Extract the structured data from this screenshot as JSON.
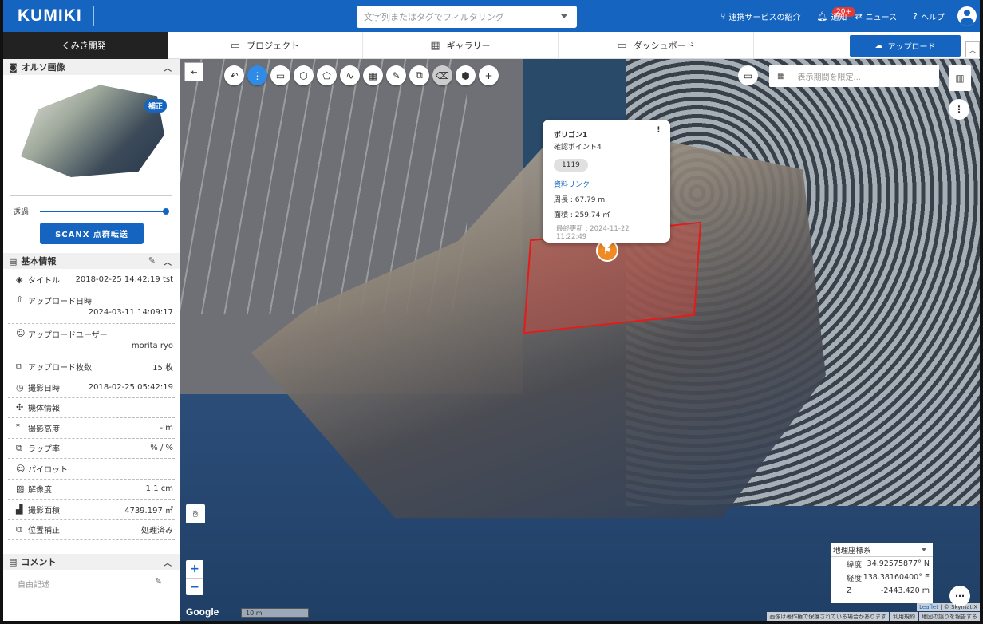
{
  "header": {
    "logo": "KUMIKI",
    "search_placeholder": "文字列またはタグでフィルタリング",
    "links": {
      "integration": "連携サービスの紹介",
      "notice": "通知",
      "notice_badge": "20+",
      "news": "ニュース",
      "help": "ヘルプ"
    }
  },
  "nav": {
    "home": "くみき開発",
    "tabs": [
      "プロジェクト",
      "ギャラリー",
      "ダッシュボード"
    ],
    "upload": "アップロード"
  },
  "sidebar": {
    "ortho_title": "オルソ画像",
    "ortho_badge": "補正",
    "transparency_label": "透過",
    "transparency_value": 1.0,
    "scanx_button": "SCANX 点群転送",
    "basic_title": "基本情報",
    "info": [
      {
        "label": "タイトル",
        "value": "2018-02-25 14:42:19 tst",
        "icon": "layers-icon"
      },
      {
        "label": "アップロード日時",
        "value": "2024-03-11 14:09:17",
        "icon": "upload-icon"
      },
      {
        "label": "アップロードユーザー",
        "value": "morita ryo",
        "icon": "user-icon"
      },
      {
        "label": "アップロード枚数",
        "value": "15 枚",
        "icon": "images-icon"
      },
      {
        "label": "撮影日時",
        "value": "2018-02-25 05:42:19",
        "icon": "clock-icon"
      },
      {
        "label": "機体情報",
        "value": "",
        "icon": "drone-icon"
      },
      {
        "label": "撮影高度",
        "value": "- m",
        "icon": "altitude-icon"
      },
      {
        "label": "ラップ率",
        "value": "% / %",
        "icon": "overlap-icon"
      },
      {
        "label": "パイロット",
        "value": "",
        "icon": "pilot-icon"
      },
      {
        "label": "解像度",
        "value": "1.1 cm",
        "icon": "resolution-icon"
      },
      {
        "label": "撮影面積",
        "value": "4739.197 ㎡",
        "icon": "area-icon"
      },
      {
        "label": "位置補正",
        "value": "処理済み",
        "icon": "correction-icon"
      }
    ],
    "comment_title": "コメント",
    "comment_placeholder": "自由記述"
  },
  "map": {
    "date_placeholder": "表示期間を限定...",
    "popup": {
      "title": "ポリゴン1",
      "subtitle": "確認ポイント4",
      "chip": "1119",
      "link": "資料リンク",
      "perimeter": "周長 : 67.79 m",
      "area": "面積 : 259.74 ㎡",
      "updated": "最終更新 : 2024-11-22 11:22:49"
    },
    "zoom_in": "+",
    "zoom_out": "−",
    "google": "Google",
    "scale": "10 m",
    "coords": {
      "system": "地理座標系",
      "lat_label": "緯度",
      "lat": "34.92575877° N",
      "lon_label": "経度",
      "lon": "138.38160400° E",
      "z_label": "Z",
      "z": "-2443.420 m"
    },
    "attribution": "| © SkymatiX",
    "attribution_leaflet": "Leaflet",
    "terms": [
      "画像は著作権で保護されている場合があります",
      "利用規約",
      "地図の誤りを報告する"
    ]
  },
  "colors": {
    "primary": "#1565c0",
    "polygon": "#e31b1b",
    "pin": "#f08a24"
  }
}
